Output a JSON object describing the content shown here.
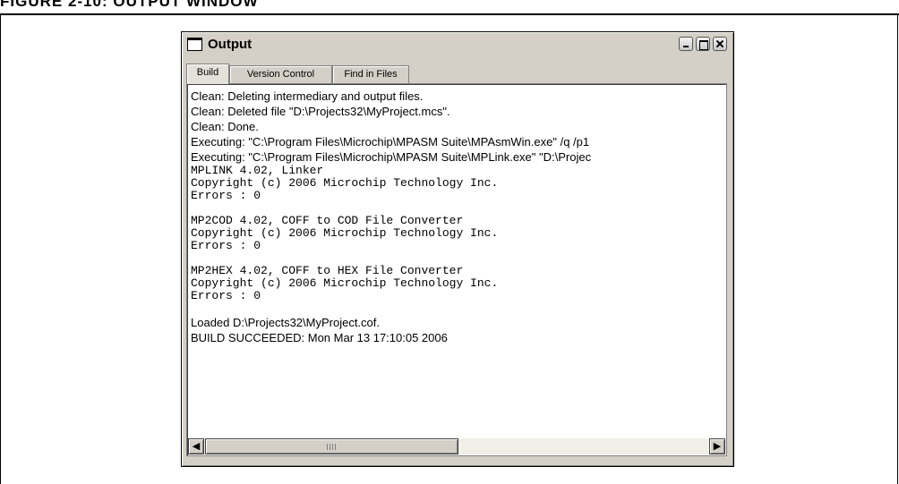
{
  "figure": {
    "caption": "FIGURE 2-10:        OUTPUT WINDOW"
  },
  "window": {
    "title": "Output",
    "icons": {
      "window": "window-icon",
      "minimize": "minimize-icon",
      "maximize": "maximize-icon",
      "close": "close-icon"
    }
  },
  "tabs": [
    {
      "label": "Build",
      "active": true
    },
    {
      "label": "Version Control",
      "active": false
    },
    {
      "label": "Find in Files",
      "active": false
    }
  ],
  "output": {
    "lines": [
      "Clean: Deleting intermediary and output files.",
      "Clean: Deleted file \"D:\\Projects32\\MyProject.mcs\".",
      "Clean: Done.",
      "Executing: \"C:\\Program Files\\Microchip\\MPASM Suite\\MPAsmWin.exe\" /q /p1",
      "Executing: \"C:\\Program Files\\Microchip\\MPASM Suite\\MPLink.exe\" \"D:\\Projec",
      "MPLINK 4.02, Linker",
      "Copyright (c) 2006 Microchip Technology Inc.",
      "Errors    : 0",
      "",
      "MP2COD 4.02, COFF to COD File Converter",
      "Copyright (c) 2006 Microchip Technology Inc.",
      "Errors    : 0",
      "",
      "MP2HEX 4.02, COFF to HEX File Converter",
      "Copyright (c) 2006 Microchip Technology Inc.",
      "Errors    : 0",
      "",
      "Loaded D:\\Projects32\\MyProject.cof.",
      "BUILD SUCCEEDED: Mon Mar 13 17:10:05 2006"
    ]
  },
  "scrollbar": {
    "left_arrow": "◀",
    "right_arrow": "▶",
    "icons": {
      "left": "arrow-left-icon",
      "right": "arrow-right-icon",
      "grip": "grip-icon"
    }
  }
}
